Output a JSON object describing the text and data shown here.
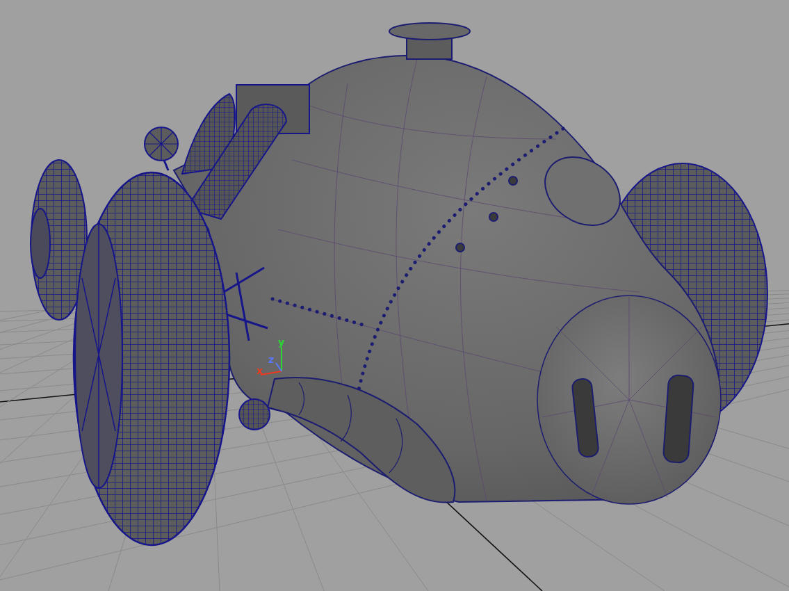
{
  "viewport": {
    "axis_gizmo": {
      "axes": [
        {
          "label": "x",
          "color": "#f03a1e"
        },
        {
          "label": "y",
          "color": "#2ad832"
        },
        {
          "label": "z",
          "color": "#5a78ff"
        }
      ]
    }
  }
}
